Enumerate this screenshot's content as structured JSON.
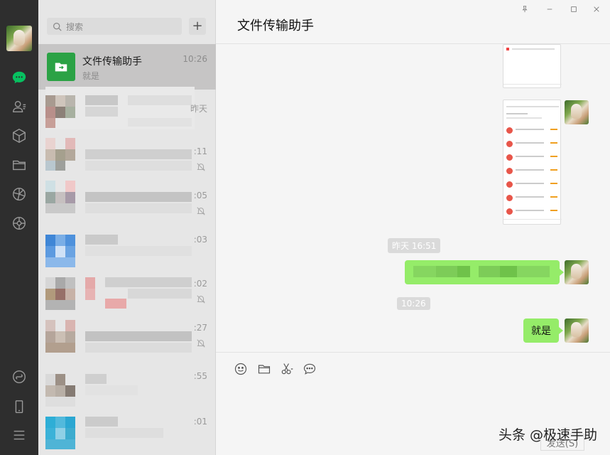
{
  "search": {
    "placeholder": "搜索"
  },
  "add_label": "+",
  "active_conversation": {
    "name": "文件传输助手",
    "time": "10:26",
    "preview": "就是"
  },
  "conversations": [
    {
      "time": "昨天",
      "muted": false
    },
    {
      "time": ":11",
      "muted": true
    },
    {
      "time": ":05",
      "muted": true
    },
    {
      "time": ":03",
      "muted": false
    },
    {
      "time": ":02",
      "muted": true
    },
    {
      "time": ":27",
      "muted": true
    },
    {
      "time": ":55",
      "muted": false
    },
    {
      "time": ":01",
      "muted": false
    }
  ],
  "chat": {
    "title": "文件传输助手",
    "timestamps": [
      "昨天 16:51",
      "10:26"
    ],
    "last_message": "就是"
  },
  "input": {
    "send_label": "发送(S)"
  },
  "watermark": "头条 @极速手助",
  "colors": {
    "accent": "#2ba245",
    "bubble": "#95ec69",
    "rail": "#2e2e2e"
  }
}
